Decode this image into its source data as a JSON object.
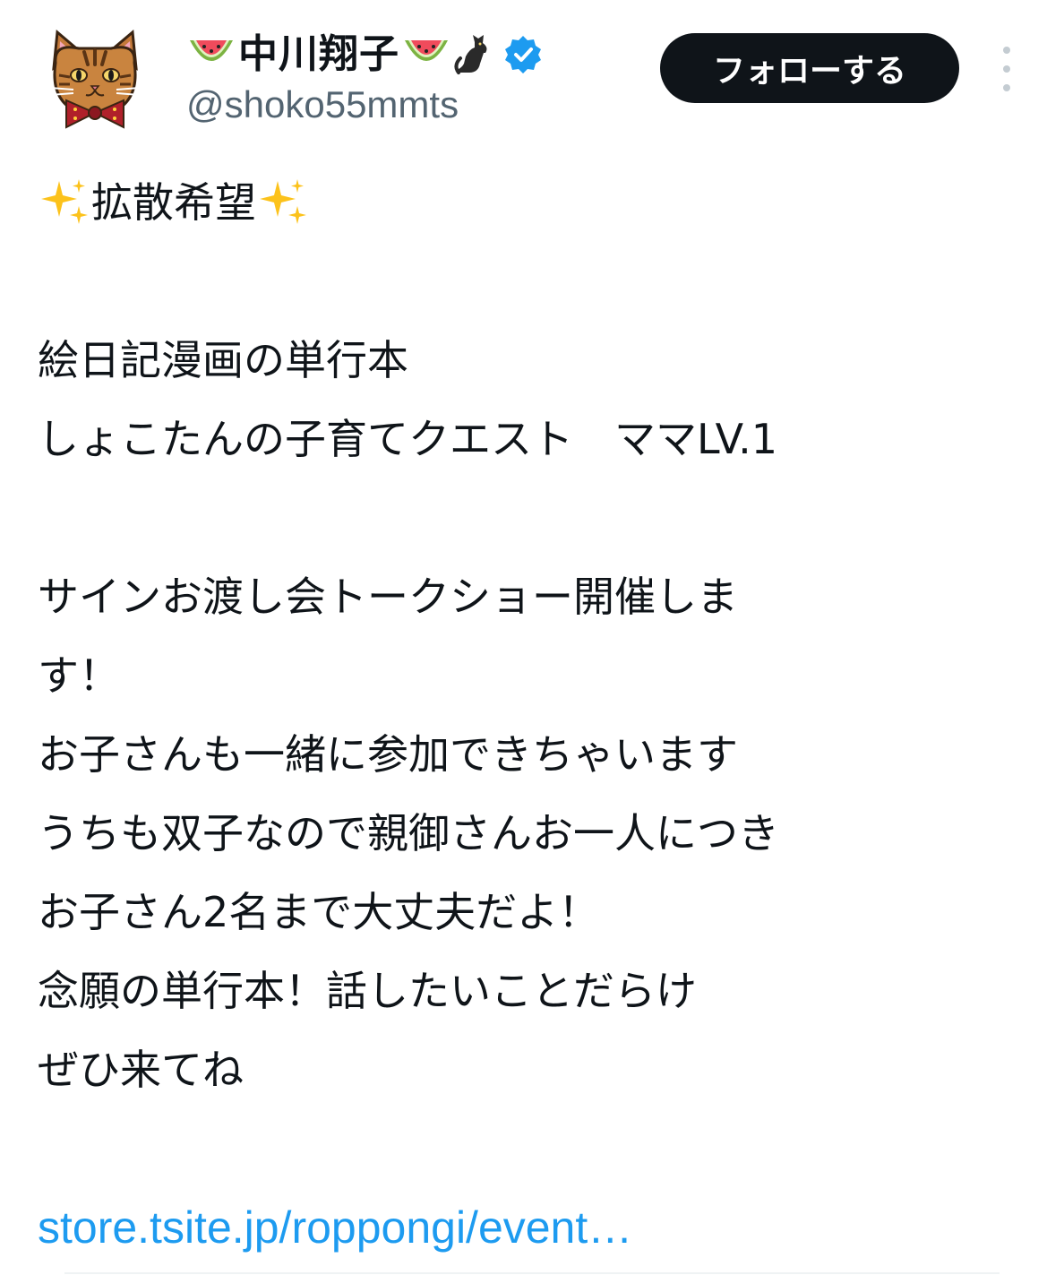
{
  "user": {
    "display_name": "中川翔子",
    "handle": "@shoko55mmts",
    "name_emojis": [
      "watermelon-icon",
      "watermelon-icon",
      "black-cat-icon",
      "verified-badge-icon"
    ],
    "avatar": "cat-avatar"
  },
  "actions": {
    "follow_label": "フォローする",
    "more_icon": "more-options-icon"
  },
  "tweet": {
    "line_1": "拡散希望",
    "line_2": "絵日記漫画の単行本",
    "line_3": "しょこたんの子育てクエスト　ママLV.1",
    "line_4": "サインお渡し会トークショー開催しま",
    "line_5": "す！",
    "line_6": "お子さんも一緒に参加できちゃいます",
    "line_7": "うちも双子なので親御さんお一人につき",
    "line_8": "お子さん2名まで大丈夫だよ！",
    "line_9": "念願の単行本！話したいことだらけ",
    "line_10": "ぜひ来てね",
    "link": "store.tsite.jp/roppongi/event…"
  },
  "colors": {
    "text": "#0f1419",
    "secondary": "#536471",
    "link": "#1d9bf0",
    "button_bg": "#0f1419",
    "verified": "#1d9bf0"
  }
}
